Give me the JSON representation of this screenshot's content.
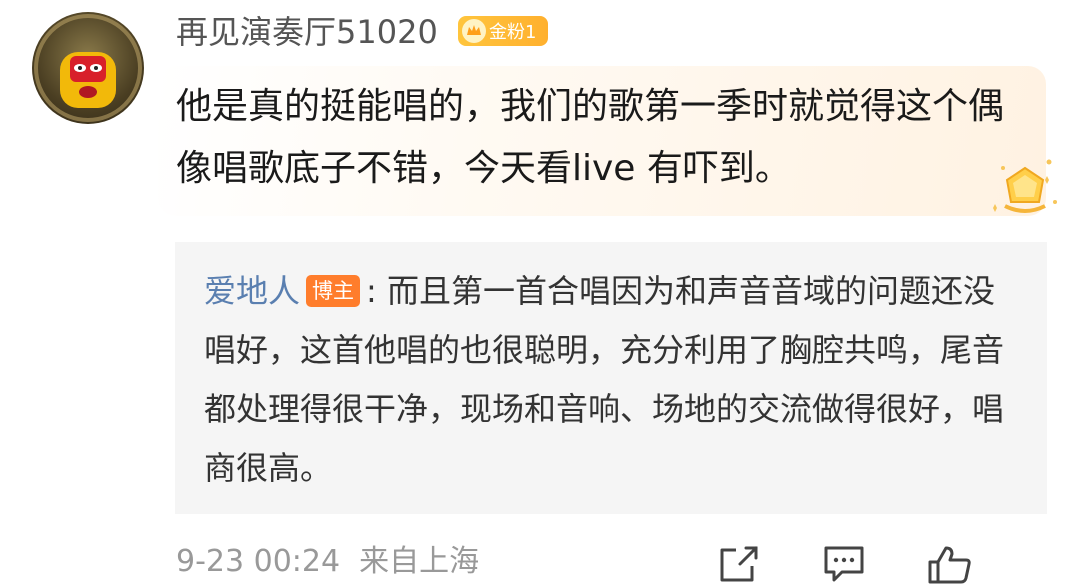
{
  "user": {
    "name": "再见演奏厅51020",
    "badge": "金粉1"
  },
  "comment": {
    "text": "他是真的挺能唱的，我们的歌第一季时就觉得这个偶像唱歌底子不错，今天看live 有吓到。"
  },
  "reply": {
    "author": "爱地人",
    "author_badge": "博主",
    "separator": ": ",
    "text": "而且第一首合唱因为和声音音域的问题还没唱好，这首他唱的也很聪明，充分利用了胸腔共鸣，尾音都处理得很干净，现场和音响、场地的交流做得很好，唱商很高。"
  },
  "footer": {
    "date": "9-23 00:24",
    "location": "来自上海"
  },
  "icons": {
    "share": "share-icon",
    "comment": "comment-icon",
    "like": "like-icon",
    "badge": "crown-icon"
  },
  "colors": {
    "badge_gold": "#ffb02e",
    "author_blue": "#5a7fb0",
    "author_badge_orange": "#ff7d2c"
  }
}
